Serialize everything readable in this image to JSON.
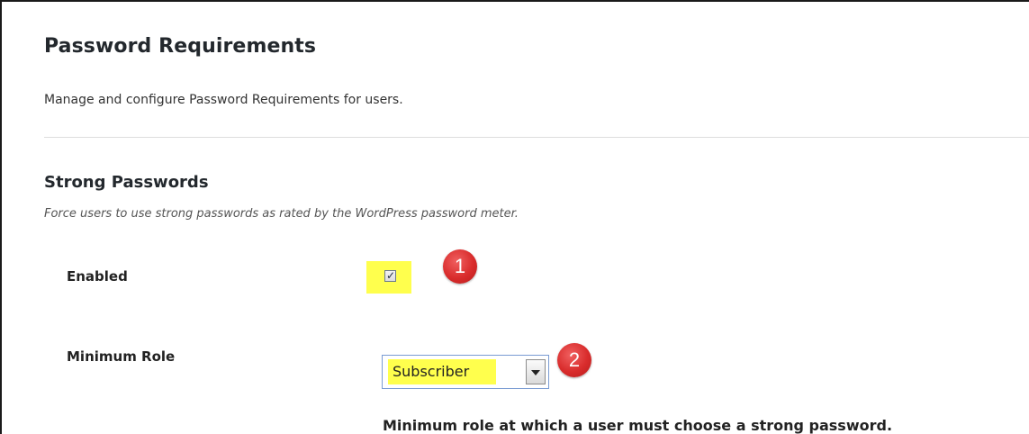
{
  "page": {
    "title": "Password Requirements",
    "description": "Manage and configure Password Requirements for users."
  },
  "section": {
    "title": "Strong Passwords",
    "description": "Force users to use strong passwords as rated by the WordPress password meter."
  },
  "fields": {
    "enabled": {
      "label": "Enabled",
      "checked": true,
      "check_glyph": "✓"
    },
    "minimum_role": {
      "label": "Minimum Role",
      "selected": "Subscriber",
      "help": "Minimum role at which a user must choose a strong password."
    }
  },
  "annotations": {
    "badge_1": "1",
    "badge_2": "2",
    "badge_color": "#d92c2c",
    "highlight_color": "#ffff4d"
  },
  "icons": {
    "checkbox": "checkmark-icon",
    "dropdown": "chevron-down-icon"
  }
}
